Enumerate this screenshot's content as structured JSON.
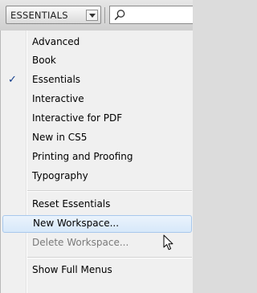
{
  "workspace_switcher": {
    "label": "ESSENTIALS",
    "dropdown_icon": "chevron-down-icon"
  },
  "search": {
    "icon": "search-icon",
    "value": ""
  },
  "menu": {
    "workspaces": [
      {
        "label": "Advanced",
        "checked": false
      },
      {
        "label": "Book",
        "checked": false
      },
      {
        "label": "Essentials",
        "checked": true
      },
      {
        "label": "Interactive",
        "checked": false
      },
      {
        "label": "Interactive for PDF",
        "checked": false
      },
      {
        "label": "New in CS5",
        "checked": false
      },
      {
        "label": "Printing and Proofing",
        "checked": false
      },
      {
        "label": "Typography",
        "checked": false
      }
    ],
    "actions": [
      {
        "label": "Reset Essentials",
        "enabled": true,
        "hovered": false
      },
      {
        "label": "New Workspace...",
        "enabled": true,
        "hovered": true
      },
      {
        "label": "Delete Workspace...",
        "enabled": false,
        "hovered": false
      }
    ],
    "footer": [
      {
        "label": "Show Full Menus",
        "enabled": true
      }
    ],
    "check_glyph": "✓"
  },
  "colors": {
    "hover_fill": "#d7e8f9",
    "hover_border": "#a8c8ec",
    "disabled_text": "#7a7a7a",
    "check": "#123c8c"
  }
}
